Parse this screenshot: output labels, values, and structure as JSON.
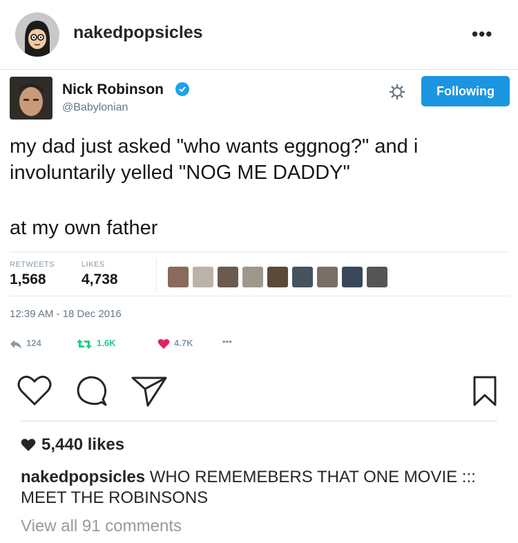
{
  "post": {
    "username": "nakedpopsicles",
    "more_label": "•••"
  },
  "tweet": {
    "author_name": "Nick Robinson",
    "author_handle": "@Babylonian",
    "follow_label": "Following",
    "text_line1": "my dad just asked \"who wants eggnog?\" and i involuntarily yelled \"NOG ME DADDY\"",
    "text_line2": "at my own father",
    "retweets_label": "RETWEETS",
    "retweets_value": "1,568",
    "likes_label": "LIKES",
    "likes_value": "4,738",
    "timestamp": "12:39 AM - 18 Dec 2016",
    "reply_count": "124",
    "retweet_count": "1.6K",
    "like_count": "4.7K",
    "more_label": "•••"
  },
  "footer": {
    "likes_text": "5,440 likes",
    "caption_user": "nakedpopsicles",
    "caption_text": " WHO REMEMEBERS THAT ONE MOVIE ::: MEET THE ROBINSONS",
    "view_all": "View all 91 comments"
  },
  "colors": {
    "follow_button": "#1b95e0",
    "verified": "#1da1f2",
    "like_heart": "#e0245e",
    "retweet": "#19cf86"
  }
}
